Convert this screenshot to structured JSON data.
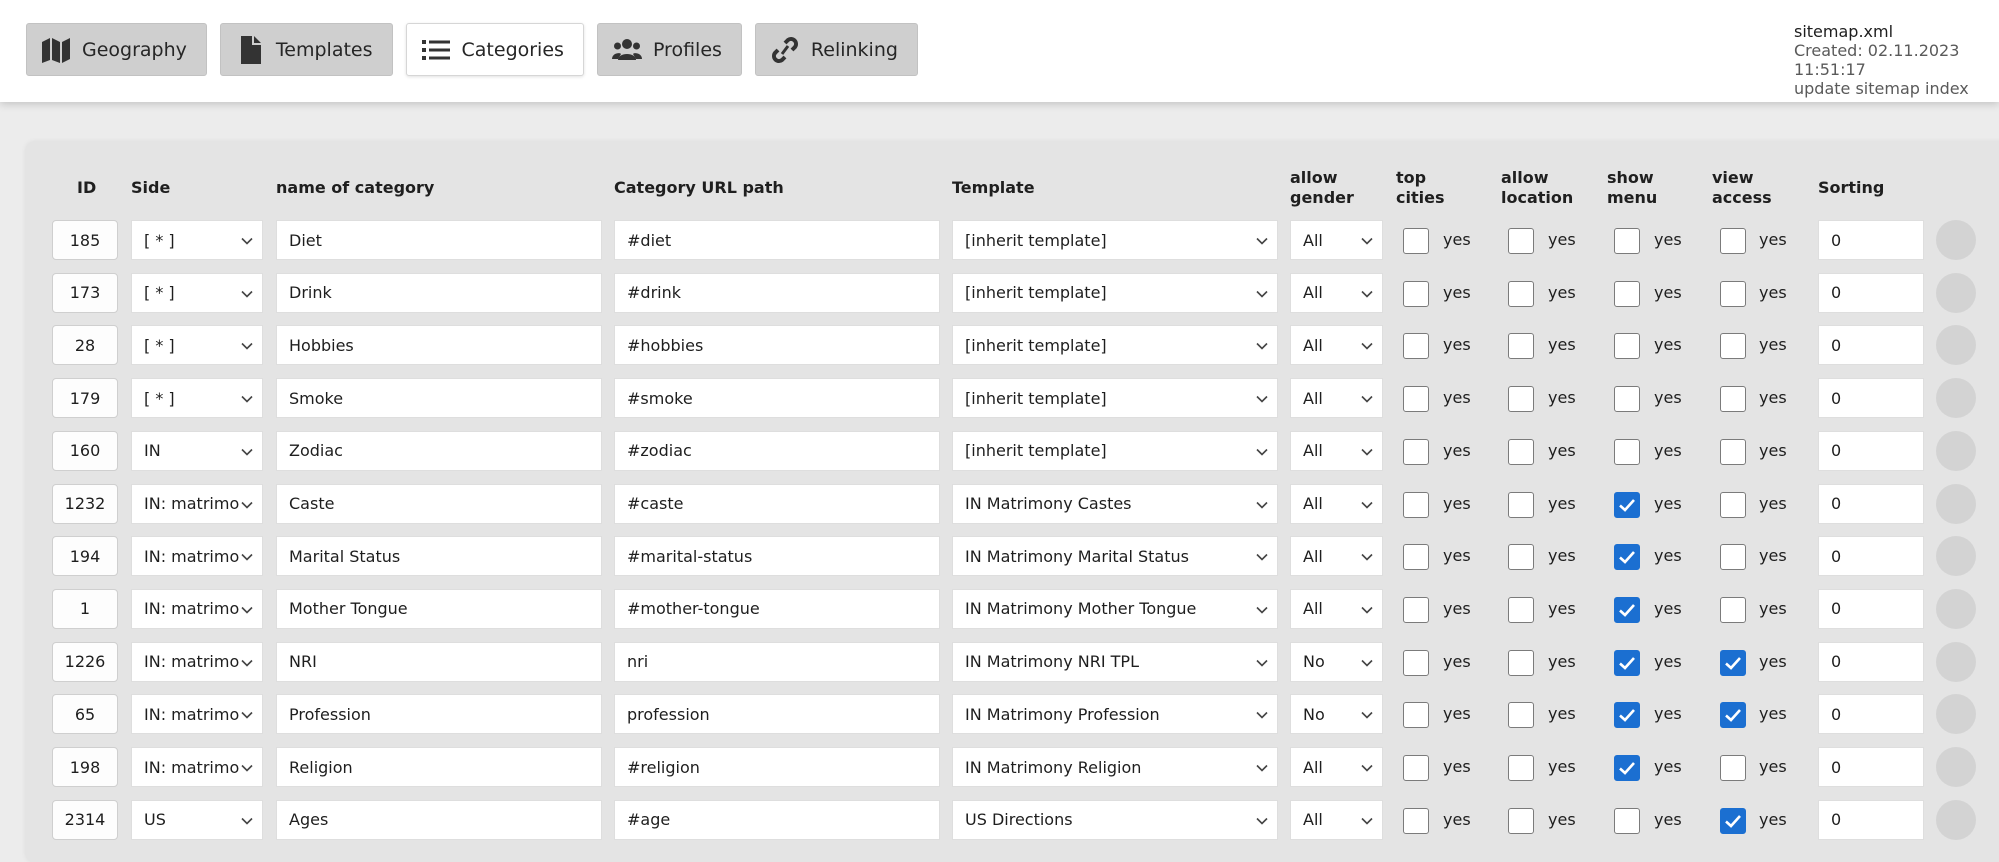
{
  "nav": [
    {
      "label": "Geography",
      "icon": "map-icon",
      "active": false
    },
    {
      "label": "Templates",
      "icon": "file-icon",
      "active": false
    },
    {
      "label": "Categories",
      "icon": "list-icon",
      "active": true
    },
    {
      "label": "Profiles",
      "icon": "users-icon",
      "active": false
    },
    {
      "label": "Relinking",
      "icon": "link-icon",
      "active": false
    }
  ],
  "sitemap": {
    "file": "sitemap.xml",
    "created": "Created: 02.11.2023 11:51:17",
    "update": "update sitemap index"
  },
  "columns": {
    "id": "ID",
    "side": "Side",
    "name": "name of category",
    "url": "Category URL path",
    "template": "Template",
    "allow_gender_1": "allow",
    "allow_gender_2": "gender",
    "top_cities_1": "top",
    "top_cities_2": "cities",
    "allow_location_1": "allow",
    "allow_location_2": "location",
    "show_menu_1": "show",
    "show_menu_2": "menu",
    "view_access_1": "view",
    "view_access_2": "access",
    "sorting": "Sorting"
  },
  "yes_label": "yes",
  "rows": [
    {
      "id": "185",
      "side": "[ * ]",
      "name": "Diet",
      "url": "#diet",
      "template": "[inherit template]",
      "gender": "All",
      "top": false,
      "loc": false,
      "menu": false,
      "access": false,
      "sorting": "0"
    },
    {
      "id": "173",
      "side": "[ * ]",
      "name": "Drink",
      "url": "#drink",
      "template": "[inherit template]",
      "gender": "All",
      "top": false,
      "loc": false,
      "menu": false,
      "access": false,
      "sorting": "0"
    },
    {
      "id": "28",
      "side": "[ * ]",
      "name": "Hobbies",
      "url": "#hobbies",
      "template": "[inherit template]",
      "gender": "All",
      "top": false,
      "loc": false,
      "menu": false,
      "access": false,
      "sorting": "0"
    },
    {
      "id": "179",
      "side": "[ * ]",
      "name": "Smoke",
      "url": "#smoke",
      "template": "[inherit template]",
      "gender": "All",
      "top": false,
      "loc": false,
      "menu": false,
      "access": false,
      "sorting": "0"
    },
    {
      "id": "160",
      "side": "IN",
      "name": "Zodiac",
      "url": "#zodiac",
      "template": "[inherit template]",
      "gender": "All",
      "top": false,
      "loc": false,
      "menu": false,
      "access": false,
      "sorting": "0"
    },
    {
      "id": "1232",
      "side": "IN: matrimo",
      "name": "Caste",
      "url": "#caste",
      "template": "IN Matrimony Castes",
      "gender": "All",
      "top": false,
      "loc": false,
      "menu": true,
      "access": false,
      "sorting": "0"
    },
    {
      "id": "194",
      "side": "IN: matrimo",
      "name": "Marital Status",
      "url": "#marital-status",
      "template": "IN Matrimony Marital Status",
      "gender": "All",
      "top": false,
      "loc": false,
      "menu": true,
      "access": false,
      "sorting": "0"
    },
    {
      "id": "1",
      "side": "IN: matrimo",
      "name": "Mother Tongue",
      "url": "#mother-tongue",
      "template": "IN Matrimony Mother Tongue",
      "gender": "All",
      "top": false,
      "loc": false,
      "menu": true,
      "access": false,
      "sorting": "0"
    },
    {
      "id": "1226",
      "side": "IN: matrimo",
      "name": "NRI",
      "url": "nri",
      "template": "IN Matrimony NRI TPL",
      "gender": "No",
      "top": false,
      "loc": false,
      "menu": true,
      "access": true,
      "sorting": "0"
    },
    {
      "id": "65",
      "side": "IN: matrimo",
      "name": "Profession",
      "url": "profession",
      "template": "IN Matrimony Profession",
      "gender": "No",
      "top": false,
      "loc": false,
      "menu": true,
      "access": true,
      "sorting": "0"
    },
    {
      "id": "198",
      "side": "IN: matrimo",
      "name": "Religion",
      "url": "#religion",
      "template": "IN Matrimony Religion",
      "gender": "All",
      "top": false,
      "loc": false,
      "menu": true,
      "access": false,
      "sorting": "0"
    },
    {
      "id": "2314",
      "side": "US",
      "name": "Ages",
      "url": "#age",
      "template": "US Directions",
      "gender": "All",
      "top": false,
      "loc": false,
      "menu": false,
      "access": true,
      "sorting": "0"
    }
  ]
}
